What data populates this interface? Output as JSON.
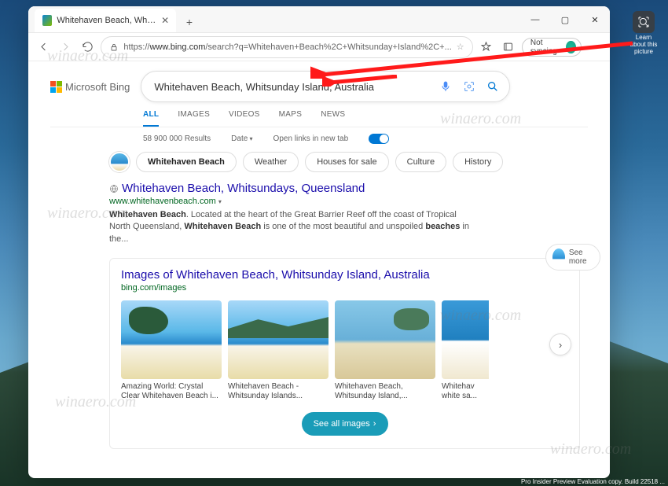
{
  "desktop": {
    "icon_label": "Learn about this picture"
  },
  "tab": {
    "title": "Whitehaven Beach, Whitsund"
  },
  "address": {
    "host": "www.bing.com",
    "path": "/search?q=Whitehaven+Beach%2C+Whitsunday+Island%2C+..."
  },
  "toolbar": {
    "sync": "Not syncing"
  },
  "bing": {
    "logo": "Microsoft Bing"
  },
  "search": {
    "query": "Whitehaven Beach, Whitsunday Island, Australia"
  },
  "scopes": [
    "ALL",
    "IMAGES",
    "VIDEOS",
    "MAPS",
    "NEWS"
  ],
  "meta": {
    "results": "58 900 000 Results",
    "date": "Date",
    "newtab": "Open links in new tab"
  },
  "entity": {
    "name": "Whitehaven Beach",
    "related": [
      "Weather",
      "Houses for sale",
      "Culture",
      "History"
    ]
  },
  "result1": {
    "title": "Whitehaven Beach, Whitsundays, Queensland",
    "url": "www.whitehavenbeach.com",
    "snippet_parts": [
      "Whitehaven Beach",
      ". Located at the heart of the Great Barrier Reef off the coast of Tropical North Queensland, ",
      "Whitehaven Beach",
      " is one of the most beautiful and unspoiled ",
      "beaches",
      " in the..."
    ]
  },
  "see_more": "See more",
  "images": {
    "heading": "Images of Whitehaven Beach, Whitsunday Island, Australia",
    "sub": "bing.com/images",
    "captions": [
      "Amazing World: Crystal Clear Whitehaven Beach i...",
      "Whitehaven Beach - Whitsunday Islands...",
      "Whitehaven Beach, Whitsunday Island,...",
      "Whitehav white sa..."
    ],
    "see_all": "See all images"
  },
  "watermark": "winaero.com",
  "taskbar": "Pro Insider Preview Evaluation copy. Build 22518 ..."
}
